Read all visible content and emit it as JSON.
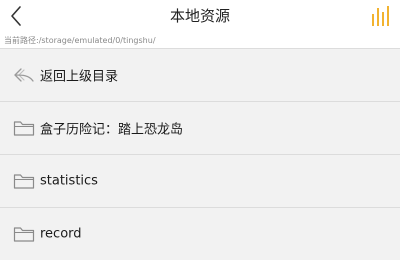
{
  "header": {
    "title": "本地资源",
    "back_icon": "chevron-left-icon",
    "equalizer_icon": "equalizer-bars-icon",
    "accent_color": "#f2b330"
  },
  "path": {
    "text": "当前路径:/storage/emulated/0/tingshu/"
  },
  "list": {
    "items": [
      {
        "label": "返回上级目录",
        "icon": "return-arrow-icon"
      },
      {
        "label": "盒子历险记：踏上恐龙岛",
        "icon": "folder-icon"
      },
      {
        "label": "statistics",
        "icon": "folder-icon"
      },
      {
        "label": "record",
        "icon": "folder-icon"
      }
    ]
  }
}
